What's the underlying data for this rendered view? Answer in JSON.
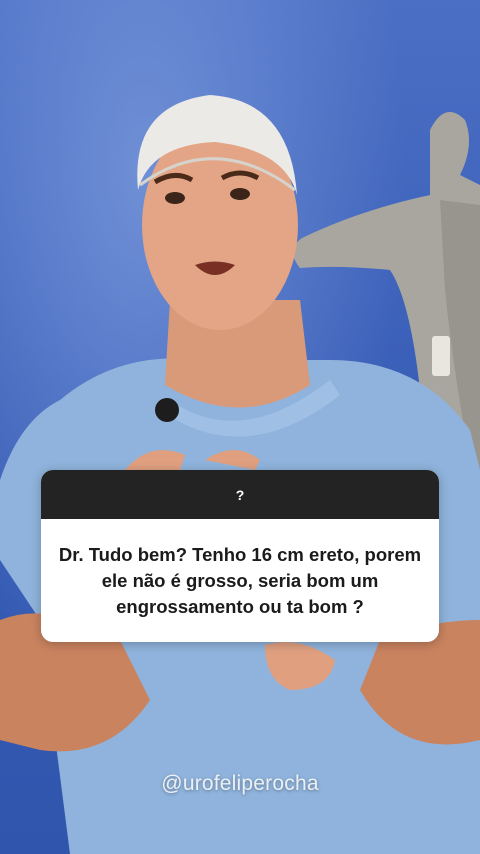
{
  "question_box": {
    "header": "?",
    "text": "Dr. Tudo bem? Tenho 16 cm ereto, porem ele não é grosso, seria bom um engrossamento ou ta bom ?"
  },
  "watermark": "@urofeliperocha"
}
